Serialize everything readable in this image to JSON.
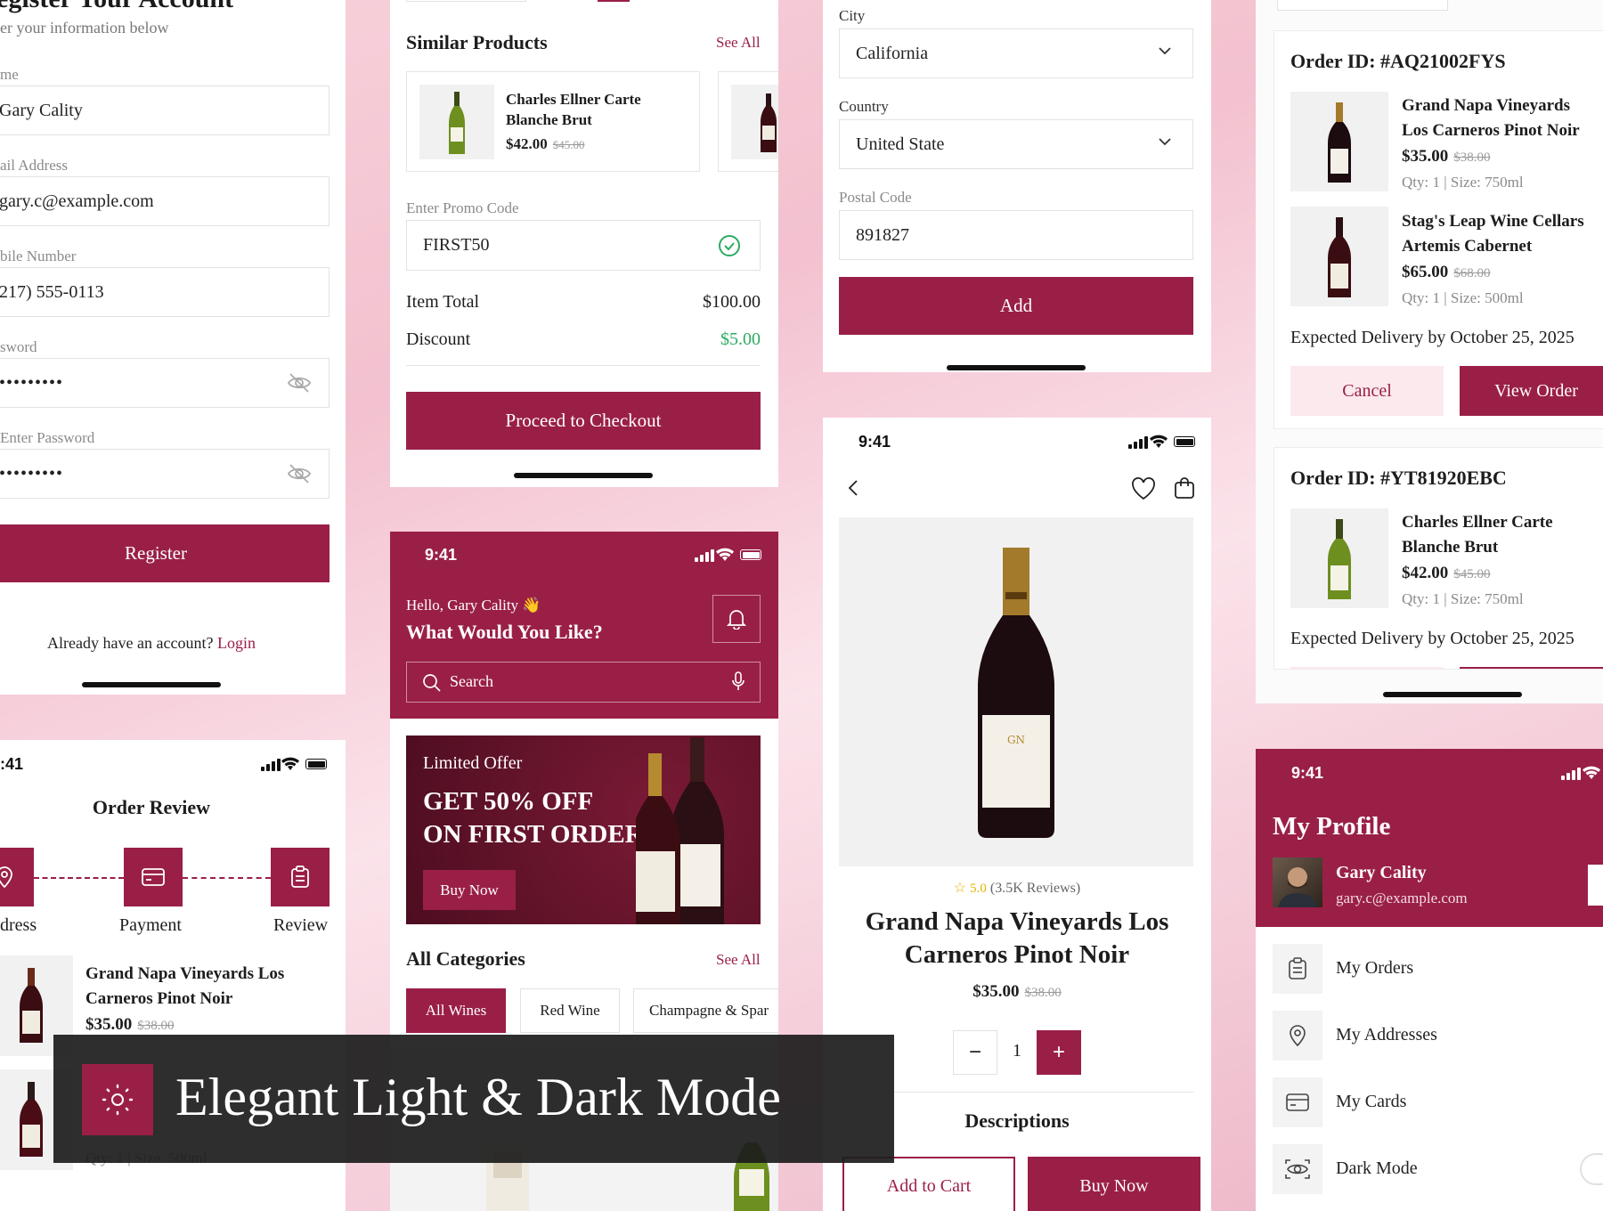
{
  "register": {
    "heading": "egister Your Account",
    "subtitle": "er your information below",
    "name_label": "me",
    "name_value": "Gary Cality",
    "email_label": "ail Address",
    "email_value": "gary.c@example.com",
    "mobile_label": "bile Number",
    "mobile_value": "217) 555-0113",
    "password_label": "sword",
    "password_value": "•••••••••",
    "confirm_label": "Enter Password",
    "confirm_value": "•••••••••",
    "register_button": "Register",
    "have_account": "Already have an account?",
    "login_link": "Login"
  },
  "order_review": {
    "time": ":41",
    "title": "Order Review",
    "steps": [
      "dress",
      "Payment",
      "Review"
    ],
    "item1_name_line1": "Grand Napa Vineyards Los",
    "item1_name_line2": "Carneros Pinot Noir",
    "item1_price": "$35.00",
    "item1_old_price": "$38.00",
    "item2_meta": "Qty: 1 | Size: 500ml"
  },
  "cart": {
    "similar_title": "Similar Products",
    "see_all": "See All",
    "similar_name_line1": "Charles Ellner Carte",
    "similar_name_line2": "Blanche Brut",
    "similar_price": "$42.00",
    "similar_old_price": "$45.00",
    "promo_label": "Enter Promo Code",
    "promo_value": "FIRST50",
    "item_total_label": "Item Total",
    "item_total_value": "$100.00",
    "discount_label": "Discount",
    "discount_value": "$5.00",
    "checkout_button": "Proceed to Checkout"
  },
  "home": {
    "time": "9:41",
    "greeting": "Hello, Gary Cality 👋",
    "question": "What Would You Like?",
    "search_placeholder": "Search",
    "offer_label": "Limited Offer",
    "offer_line1": "GET 50% OFF",
    "offer_line2": "ON FIRST ORDER",
    "buy_now": "Buy Now",
    "categories_title": "All Categories",
    "see_all": "See All",
    "categories": [
      "All Wines",
      "Red Wine",
      "Champagne & Spar"
    ]
  },
  "address": {
    "city_label": "City",
    "city_value": "California",
    "country_label": "Country",
    "country_value": "United State",
    "postal_label": "Postal Code",
    "postal_value": "891827",
    "add_button": "Add"
  },
  "product": {
    "time": "9:41",
    "rating": "5.0",
    "reviews": "(3.5K Reviews)",
    "name_line1": "Grand Napa Vineyards Los",
    "name_line2": "Carneros Pinot Noir",
    "price": "$35.00",
    "old_price": "$38.00",
    "qty": "1",
    "descriptions": "Descriptions",
    "add_to_cart": "Add to Cart",
    "buy_now": "Buy Now"
  },
  "orders": {
    "order1_id": "Order ID: #AQ21002FYS",
    "o1i1_line1": "Grand Napa Vineyards",
    "o1i1_line2": "Los Carneros Pinot Noir",
    "o1i1_price": "$35.00",
    "o1i1_old": "$38.00",
    "o1i1_meta": "Qty: 1 | Size: 750ml",
    "o1i2_line1": "Stag's Leap Wine Cellars",
    "o1i2_line2": "Artemis Cabernet",
    "o1i2_price": "$65.00",
    "o1i2_old": "$68.00",
    "o1i2_meta": "Qty: 1 | Size: 500ml",
    "delivery1": "Expected Delivery by October 25, 2025",
    "cancel": "Cancel",
    "view_order": "View Order",
    "order2_id": "Order ID: #YT81920EBC",
    "o2i1_line1": "Charles Ellner Carte",
    "o2i1_line2": "Blanche Brut",
    "o2i1_price": "$42.00",
    "o2i1_old": "$45.00",
    "o2i1_meta": "Qty: 1 | Size: 750ml",
    "delivery2": "Expected Delivery by October 25, 2025"
  },
  "profile": {
    "time": "9:41",
    "title": "My Profile",
    "name": "Gary Cality",
    "email": "gary.c@example.com",
    "menu": [
      "My Orders",
      "My Addresses",
      "My Cards",
      "Dark Mode"
    ]
  },
  "banner": {
    "text": "Elegant Light & Dark Mode"
  },
  "colors": {
    "accent": "#9a1f47",
    "success": "#2bab62",
    "background": "#f4c6d3"
  }
}
